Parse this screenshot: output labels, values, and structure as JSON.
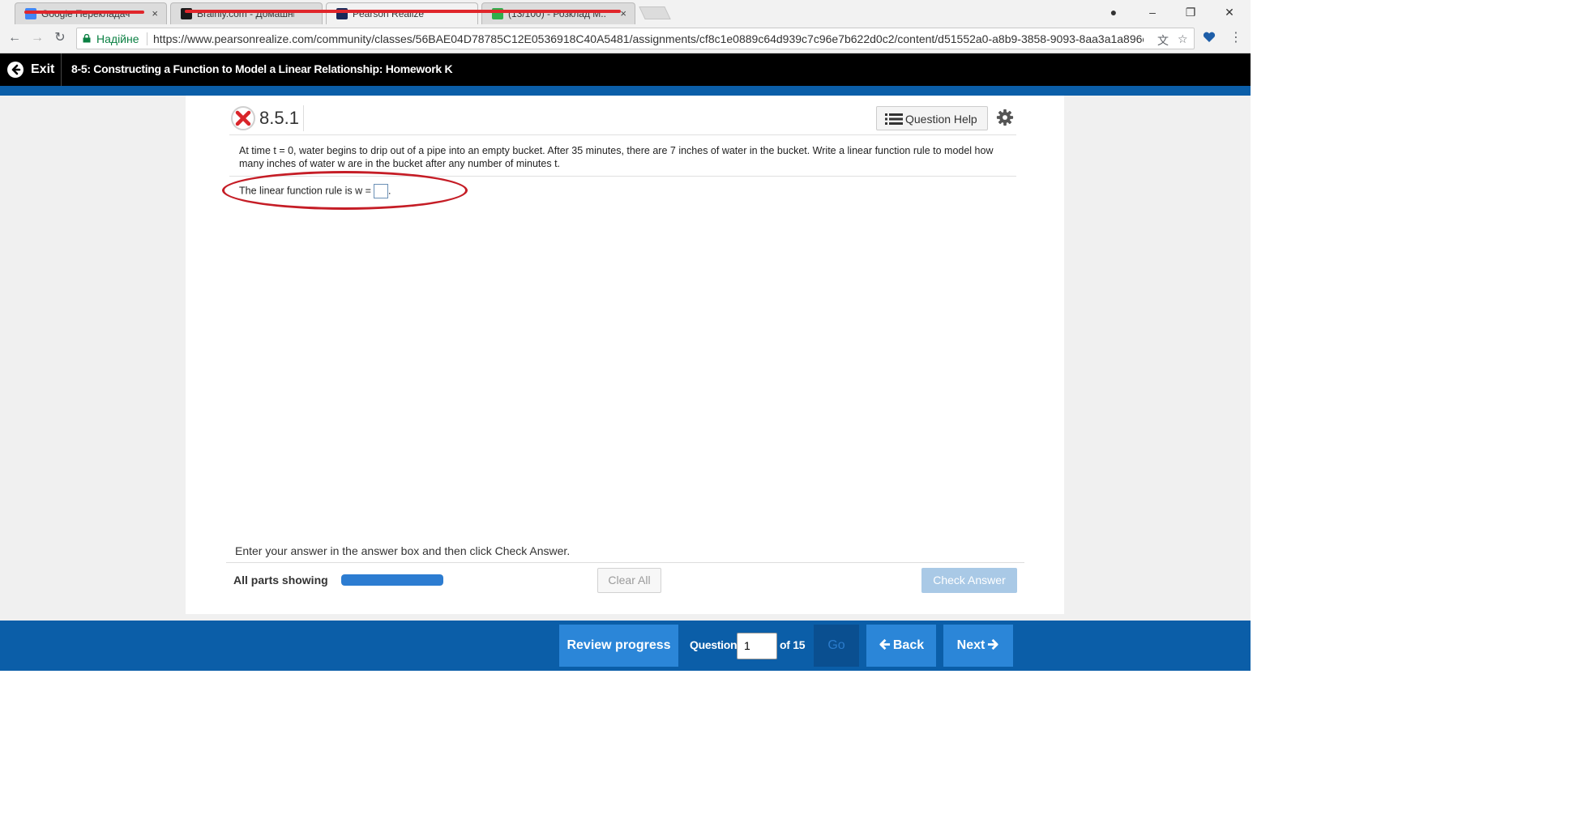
{
  "browser": {
    "tabs": [
      {
        "title": "Google Перекладач",
        "favicon_color": "#4285f4"
      },
      {
        "title": "Brainly.com - Домашні",
        "favicon_color": "#1a1a1a"
      },
      {
        "title": "Pearson Realize",
        "favicon_color": "#1a2a5a"
      },
      {
        "title": "(13/100) - Розклад M...",
        "favicon_color": "#2fae4c"
      }
    ],
    "tab_close_glyph": "×",
    "window_controls": {
      "minimize": "–",
      "restore": "❐",
      "close": "✕"
    },
    "nav": {
      "back": "←",
      "forward": "→",
      "reload": "↻"
    },
    "secure_label": "Надійне",
    "url": "https://www.pearsonrealize.com/community/classes/56BAE04D78785C12E0536918C40A5481/assignments/cf8c1e0889c64d939c7c96e7b622d0c2/content/d51552a0-a8b9-3858-9093-8aa3a1a896e...",
    "translate_icon": "文",
    "star_icon": "☆",
    "menu_icon": "⋮",
    "profile_icon": "●"
  },
  "app": {
    "exit_label": "Exit",
    "assignment_title": "8-5: Constructing a Function to Model a Linear Relationship: Homework K"
  },
  "question": {
    "number": "8.5.1",
    "status": "incorrect",
    "help_label": "Question Help",
    "text": "At time t = 0, water begins to drip out of a pipe into an empty bucket. After 35 minutes, there are 7 inches of water in the bucket. Write a linear function rule to model how many inches of water w are in the bucket after any number of minutes t.",
    "answer_prefix": "The linear function rule is w =",
    "answer_suffix": ".",
    "answer_value": ""
  },
  "footer": {
    "instruction": "Enter your answer in the answer box and then click Check Answer.",
    "all_parts_label": "All parts showing",
    "parts_progress": 1.0,
    "clear_all_label": "Clear All",
    "check_answer_label": "Check Answer"
  },
  "bottom_nav": {
    "review_progress_label": "Review progress",
    "question_label": "Question",
    "question_value": "1",
    "of_label": "of 15",
    "go_label": "Go",
    "back_label": "Back",
    "next_label": "Next"
  },
  "colors": {
    "header_bg": "#000000",
    "brand_blue": "#0b5ea8",
    "button_blue": "#2b86d8",
    "error_red": "#d9252a",
    "annotation_red": "#c51d26"
  }
}
